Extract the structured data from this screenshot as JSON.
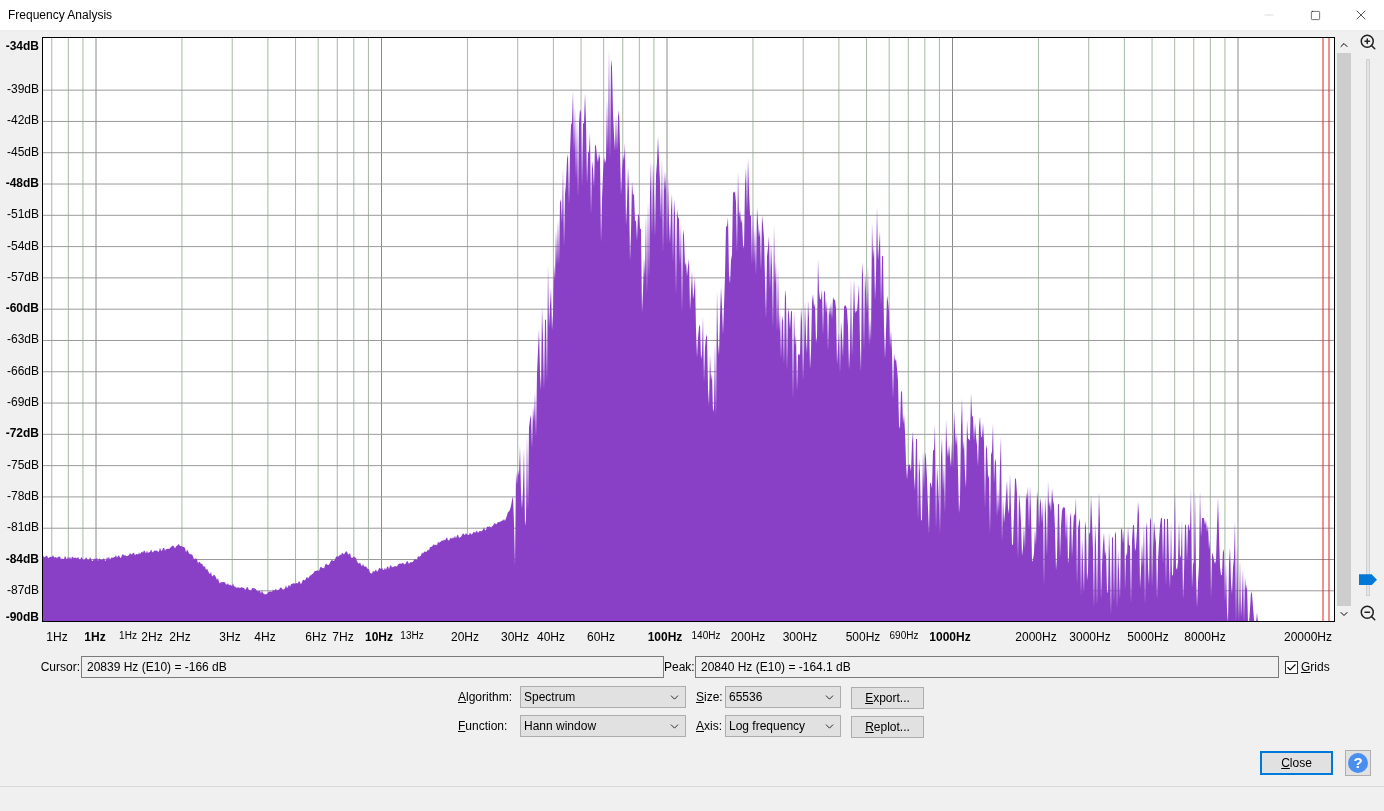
{
  "window": {
    "title": "Frequency Analysis",
    "minimize_disabled": true
  },
  "plot": {
    "y_labels": [
      {
        "text": "-34dB",
        "major": true
      },
      {
        "text": "-39dB",
        "major": false
      },
      {
        "text": "-42dB",
        "major": false
      },
      {
        "text": "-45dB",
        "major": false
      },
      {
        "text": "-48dB",
        "major": true
      },
      {
        "text": "-51dB",
        "major": false
      },
      {
        "text": "-54dB",
        "major": false
      },
      {
        "text": "-57dB",
        "major": false
      },
      {
        "text": "-60dB",
        "major": true
      },
      {
        "text": "-63dB",
        "major": false
      },
      {
        "text": "-66dB",
        "major": false
      },
      {
        "text": "-69dB",
        "major": false
      },
      {
        "text": "-72dB",
        "major": true
      },
      {
        "text": "-75dB",
        "major": false
      },
      {
        "text": "-78dB",
        "major": false
      },
      {
        "text": "-81dB",
        "major": false
      },
      {
        "text": "-84dB",
        "major": true
      },
      {
        "text": "-87dB",
        "major": false
      },
      {
        "text": "-90dB",
        "major": true
      }
    ],
    "x_labels": [
      {
        "text": "1Hz",
        "kind": "normal"
      },
      {
        "text": "1Hz",
        "kind": "major"
      },
      {
        "text": "1Hz",
        "kind": "small"
      },
      {
        "text": "2Hz",
        "kind": "normal"
      },
      {
        "text": "2Hz",
        "kind": "normal"
      },
      {
        "text": "3Hz",
        "kind": "normal"
      },
      {
        "text": "4Hz",
        "kind": "normal"
      },
      {
        "text": "6Hz",
        "kind": "normal"
      },
      {
        "text": "7Hz",
        "kind": "normal"
      },
      {
        "text": "10Hz",
        "kind": "major"
      },
      {
        "text": "13Hz",
        "kind": "small"
      },
      {
        "text": "20Hz",
        "kind": "normal"
      },
      {
        "text": "30Hz",
        "kind": "normal"
      },
      {
        "text": "40Hz",
        "kind": "normal"
      },
      {
        "text": "60Hz",
        "kind": "normal"
      },
      {
        "text": "100Hz",
        "kind": "major"
      },
      {
        "text": "140Hz",
        "kind": "small"
      },
      {
        "text": "200Hz",
        "kind": "normal"
      },
      {
        "text": "300Hz",
        "kind": "normal"
      },
      {
        "text": "500Hz",
        "kind": "normal"
      },
      {
        "text": "690Hz",
        "kind": "small"
      },
      {
        "text": "1000Hz",
        "kind": "major"
      },
      {
        "text": "2000Hz",
        "kind": "normal"
      },
      {
        "text": "3000Hz",
        "kind": "normal"
      },
      {
        "text": "5000Hz",
        "kind": "normal"
      },
      {
        "text": "8000Hz",
        "kind": "normal"
      },
      {
        "text": "20000Hz",
        "kind": "normal"
      }
    ],
    "zoom_slider": {
      "level": 0.02
    }
  },
  "cursor": {
    "label": "Cursor:",
    "value": "20839 Hz (E10) = -166 dB"
  },
  "peak": {
    "label": "Peak:",
    "value": "20840 Hz (E10) = -164.1 dB"
  },
  "grids": {
    "label": "Grids",
    "checked": true
  },
  "algorithm": {
    "label": "Algorithm:",
    "value": "Spectrum"
  },
  "size": {
    "label": "Size:",
    "value": "65536"
  },
  "export_button": "Export...",
  "function": {
    "label": "Function:",
    "value": "Hann window"
  },
  "axis": {
    "label": "Axis:",
    "value": "Log frequency"
  },
  "replot_button": "Replot...",
  "close_button": {
    "label": "Close",
    "focused": true
  },
  "help_button": "?"
}
